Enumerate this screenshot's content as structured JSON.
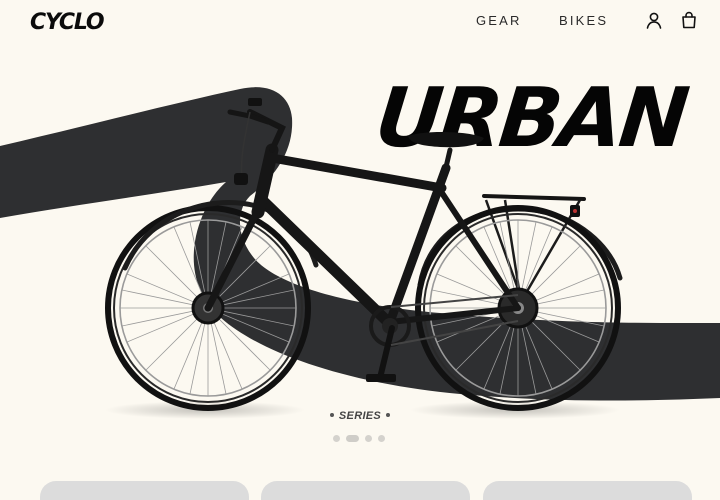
{
  "brand": {
    "logo_text": "CYCLO"
  },
  "nav": {
    "items": [
      {
        "label": "GEAR"
      },
      {
        "label": "BIKES"
      }
    ]
  },
  "header_icons": [
    "user-icon",
    "shopping-bag-icon"
  ],
  "hero": {
    "headline": "URBAN",
    "subtitle": "SERIES",
    "pager": {
      "count": 4,
      "active_index": 1
    }
  },
  "colors": {
    "background": "#fcf9f1",
    "swoosh": "#2e2f31",
    "text": "#0b0b0b",
    "card": "#dcdcdc"
  },
  "cards": [
    {},
    {},
    {}
  ]
}
